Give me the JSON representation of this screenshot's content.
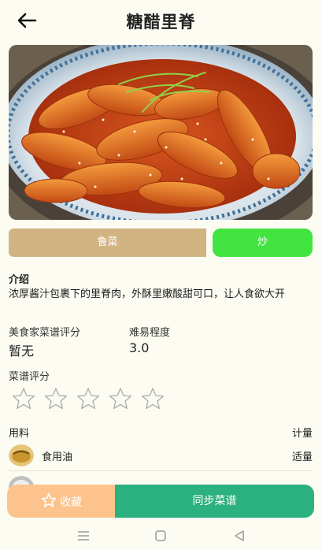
{
  "header": {
    "title": "糖醋里脊"
  },
  "tags": {
    "cuisine": "鲁菜",
    "method": "炒"
  },
  "intro": {
    "title": "介绍",
    "text": "浓厚酱汁包裹下的里脊肉，外酥里嫩酸甜可口，让人食欲大开"
  },
  "ratings": {
    "gourmet_label": "美食家菜谱评分",
    "gourmet_value": "暂无",
    "difficulty_label": "难易程度",
    "difficulty_value": "3.0",
    "user_label": "菜谱评分",
    "user_stars": 0,
    "max_stars": 5
  },
  "ingredients": {
    "header_left": "用料",
    "header_right": "计量",
    "items": [
      {
        "name": "食用油",
        "amount": "适量"
      }
    ]
  },
  "actions": {
    "favorite": "收藏",
    "sync": "同步菜谱"
  },
  "colors": {
    "background": "#fdfcf3",
    "cuisine_tag": "#d2b483",
    "method_tag": "#42e442",
    "favorite": "#fcc48c",
    "sync": "#2bb07f"
  },
  "icons": {
    "back": "arrow-left-icon",
    "star": "star-outline-icon",
    "favorite": "star-outline-icon",
    "nav_menu": "menu-icon",
    "nav_home": "square-icon",
    "nav_back": "triangle-left-icon"
  }
}
